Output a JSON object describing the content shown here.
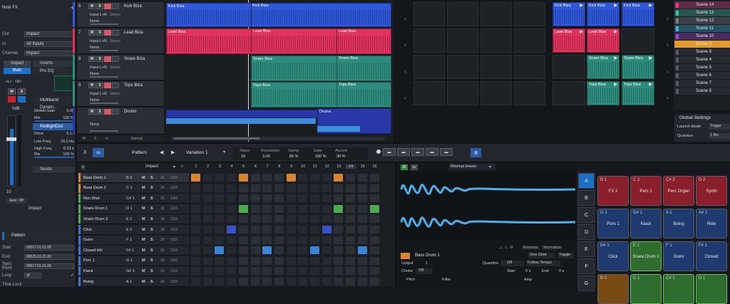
{
  "inspector": {
    "note_fx": "Note FX",
    "io": [
      {
        "label": "Out",
        "value": "Impact"
      },
      {
        "label": "In",
        "value": "All Inputs"
      },
      {
        "label": "Channel",
        "value": "Impact"
      }
    ],
    "channel_name": "Impact",
    "tab_main": "Main",
    "insert_label": "Inserts",
    "inserts": [
      "Pro EQ",
      "Multiband Dynam...",
      "RedlightDist"
    ],
    "params": [
      {
        "label": "Global Gain",
        "value": "0.00"
      },
      {
        "label": "Mix",
        "value": "100 %"
      },
      {
        "label": "Drive",
        "value": "5.17"
      },
      {
        "label": "Low Freq",
        "value": "20.0 Hz"
      },
      {
        "label": "High Freq",
        "value": "6.53 k"
      },
      {
        "label": "Mix",
        "value": "100 %"
      }
    ],
    "sends": "Sends",
    "db": "0dB",
    "fader_num": "10",
    "auto": "Auto: Off",
    "impact_label": "Impact",
    "pattern_header": "Pattern",
    "pattern_fields": [
      {
        "label": "Start",
        "value": "00017.01.01.00"
      },
      {
        "label": "End",
        "value": "00025.01.01.00"
      },
      {
        "label": "Sync Point",
        "value": "00017.01.01.00"
      },
      {
        "label": "Loop",
        "value": "⇄"
      },
      {
        "label": "Time Lock",
        "value": ""
      }
    ]
  },
  "tracks": [
    {
      "num": "6",
      "name": "Kick Biza",
      "input": "Input L+R",
      "mode": "Stereo",
      "out": "None",
      "color": "#2e57d9"
    },
    {
      "num": "7",
      "name": "Lead Biza",
      "input": "Input L+R",
      "mode": "Stereo",
      "out": "None",
      "color": "#e1325d"
    },
    {
      "num": "8",
      "name": "Snare Biza",
      "input": "Input L+R",
      "mode": "Stereo",
      "out": "None",
      "color": "#2d8c7e"
    },
    {
      "num": "9",
      "name": "Tops Biza",
      "input": "Input L+R",
      "mode": "Stereo",
      "out": "None",
      "color": "#2d8c7e"
    },
    {
      "num": "",
      "name": "Drums",
      "input": "",
      "mode": "",
      "out": "None",
      "color": "#2838a6"
    }
  ],
  "arr_clips": {
    "kick": "Kick Biza",
    "lead": "Lead Biza",
    "snare": "Snare Biza",
    "tops": "Tops Biza",
    "drums": "Drums"
  },
  "normal": "Normal",
  "launcher_clips": {
    "kick": "Kick Biza",
    "lead": "Lead Biza",
    "snare": "Snare Biza",
    "tops": "Tops Biza"
  },
  "scenes": [
    {
      "name": "Scene 14",
      "color": "#ea3f86"
    },
    {
      "name": "Scene 13",
      "color": "#3fc2a6"
    },
    {
      "name": "Scene 12",
      "color": "#7a7f86"
    },
    {
      "name": "Scene 11",
      "color": "#3ab6e0"
    },
    {
      "name": "Scene 10",
      "color": "#a04bd6"
    },
    {
      "name": "Scene 9",
      "color": "#e39a2a"
    },
    {
      "name": "Scene 8",
      "color": "#565b62"
    },
    {
      "name": "Scene 4",
      "color": "#565b62"
    },
    {
      "name": "Scene 5",
      "color": "#565b62"
    },
    {
      "name": "Scene 6",
      "color": "#565b62"
    },
    {
      "name": "Scene 7",
      "color": "#565b62"
    },
    {
      "name": "Scene 8",
      "color": "#565b62"
    }
  ],
  "global": {
    "title": "Global Settings",
    "launch_label": "Launch Mode",
    "launch_value": "Trigge",
    "quantize_label": "Quantize",
    "quantize_value": "1 Ba"
  },
  "pattern_bar": {
    "num": "3",
    "pattern": "Pattern",
    "variation": "Variation 1",
    "cols": [
      {
        "label": "Steps",
        "value": "16"
      },
      {
        "label": "Resolution",
        "value": "1/16"
      },
      {
        "label": "Swing",
        "value": "65 %"
      },
      {
        "label": "Gate",
        "value": "100 %"
      },
      {
        "label": "Accent",
        "value": "30 %"
      }
    ]
  },
  "editor": {
    "instrument": "Impact",
    "step_nums": [
      "1",
      "2",
      "3",
      "4",
      "5",
      "6",
      "7",
      "8",
      "9",
      "10",
      "11",
      "12",
      "13",
      "14",
      "15",
      "16"
    ],
    "rows": [
      {
        "name": "Bass Drum 1",
        "note": "B 0",
        "color": "#d8862e",
        "steps": [
          1,
          5,
          9,
          13
        ],
        "stepcolor": "#d8862e"
      },
      {
        "name": "Bass Drum 2",
        "note": "C 1",
        "color": "#d8862e",
        "steps": [],
        "stepcolor": "#d8862e"
      },
      {
        "name": "Rim Shot",
        "note": "C# 1",
        "color": "#4caa4f",
        "steps": [],
        "stepcolor": "#4caa4f"
      },
      {
        "name": "Snare Drum 1",
        "note": "D 1",
        "color": "#4caa4f",
        "steps": [
          5,
          13,
          16
        ],
        "stepcolor": "#4caa4f"
      },
      {
        "name": "Snare Drum 2",
        "note": "E 1",
        "color": "#4caa4f",
        "steps": [],
        "stepcolor": "#4caa4f"
      },
      {
        "name": "Click",
        "note": "E 1",
        "color": "#3a6fd8",
        "steps": [
          4,
          12
        ],
        "stepcolor": "#3a52c8"
      },
      {
        "name": "Guiro",
        "note": "F 1",
        "color": "#3a6fd8",
        "steps": [],
        "stepcolor": "#3a6fd8"
      },
      {
        "name": "Closed HH",
        "note": "F# 1",
        "color": "#3a6fd8",
        "steps": [
          3,
          7,
          11,
          15
        ],
        "stepcolor": "#3a84d8"
      },
      {
        "name": "Perc 1",
        "note": "G 1",
        "color": "#3a6fd8",
        "steps": [],
        "stepcolor": "#3a6fd8"
      },
      {
        "name": "Klack",
        "note": "G# 1",
        "color": "#3a6fd8",
        "steps": [],
        "stepcolor": "#3a6fd8"
      },
      {
        "name": "Boing",
        "note": "A 1",
        "color": "#3a6fd8",
        "steps": [],
        "stepcolor": "#3a6fd8"
      }
    ],
    "velocity": "16",
    "length": "1/16"
  },
  "sampler": {
    "preset": "Minimal House",
    "reverse": "Reverse",
    "normalize": "Normalize",
    "sample_name": "Bass Drum 1",
    "one_shot": "One Shot",
    "toggle": "Toggle",
    "output_label": "Output",
    "output_val": "1",
    "quantize_label": "Quantize",
    "quantize_val": "Off",
    "follow": "Follow Tempo",
    "choke_label": "Choke",
    "choke_val": "Off",
    "start_label": "Start",
    "start_val": "0 s",
    "end_label": "End",
    "end_val": "0 s",
    "pitch": "Pitch",
    "filter": "Filter",
    "amp": "Amp"
  },
  "banks": [
    "A",
    "B",
    "C",
    "D",
    "E",
    "F",
    "G"
  ],
  "pads": [
    {
      "note": "B 1",
      "label": "FX 2",
      "color": "#8a1e2a"
    },
    {
      "note": "C 2",
      "label": "Perc 2",
      "color": "#8a1e2a"
    },
    {
      "note": "C# 2",
      "label": "Perc Organ",
      "color": "#8a1e2a"
    },
    {
      "note": "D 2",
      "label": "Synth",
      "color": "#8a1e2a"
    },
    {
      "note": "G 1",
      "label": "Poro 1",
      "color": "#1e3a6e"
    },
    {
      "note": "G# 1",
      "label": "Klack",
      "color": "#1e3a6e"
    },
    {
      "note": "A 1",
      "label": "Boing",
      "color": "#1e3a6e"
    },
    {
      "note": "A# 1",
      "label": "Ride",
      "color": "#1e3a6e"
    },
    {
      "note": "D# 1",
      "label": "Click",
      "color": "#1e3a6e"
    },
    {
      "note": "E 1",
      "label": "Snare Drum 2",
      "color": "#2f6d2f"
    },
    {
      "note": "F 1",
      "label": "Guiro",
      "color": "#1e3a6e"
    },
    {
      "note": "F# 1",
      "label": "Closed",
      "color": "#1e3a6e"
    },
    {
      "note": "B 0",
      "label": "",
      "color": "#7a4a14"
    },
    {
      "note": "C 1",
      "label": "",
      "color": "#2f6d2f"
    },
    {
      "note": "C# 1",
      "label": "",
      "color": "#2f6d2f"
    },
    {
      "note": "D 1",
      "label": "",
      "color": "#2f6d2f"
    }
  ]
}
